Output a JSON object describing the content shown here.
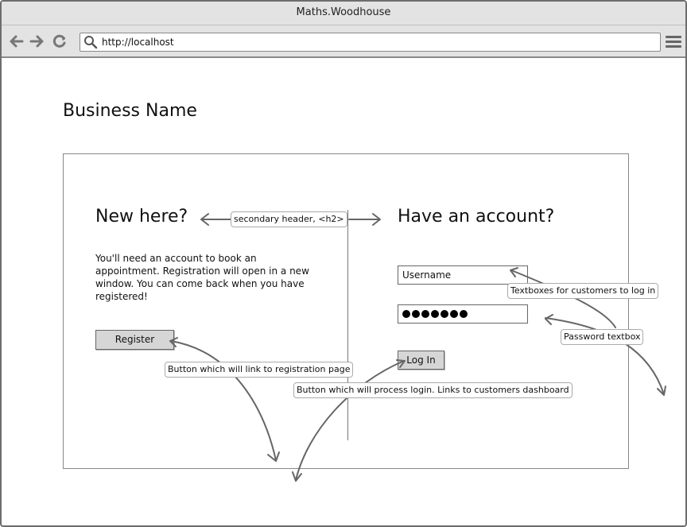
{
  "window": {
    "title": "Maths.Woodhouse"
  },
  "toolbar": {
    "url": "http://localhost",
    "back_icon": "back-arrow-icon",
    "forward_icon": "forward-arrow-icon",
    "reload_icon": "reload-icon",
    "menu_icon": "hamburger-menu-icon"
  },
  "page": {
    "business_name": "Business Name",
    "left": {
      "heading": "New here?",
      "text": "You'll need an account to book an appointment. Registration will open in a new window. You can come back when you have registered!",
      "register_label": "Register"
    },
    "right": {
      "heading": "Have an account?",
      "username_value": "Username",
      "password_mask_count": 7,
      "login_label": "Log In"
    }
  },
  "annotations": {
    "header_note": "secondary header, <h2>",
    "textboxes_note": "Textboxes for customers to log in",
    "password_note": "Password textbox",
    "register_note": "Button which will link to registration page",
    "login_note": "Button which will process login. Links to customers dashboard"
  },
  "colors": {
    "chrome": "#e3e3e3",
    "button": "#d6d6d6",
    "border": "#666666"
  }
}
